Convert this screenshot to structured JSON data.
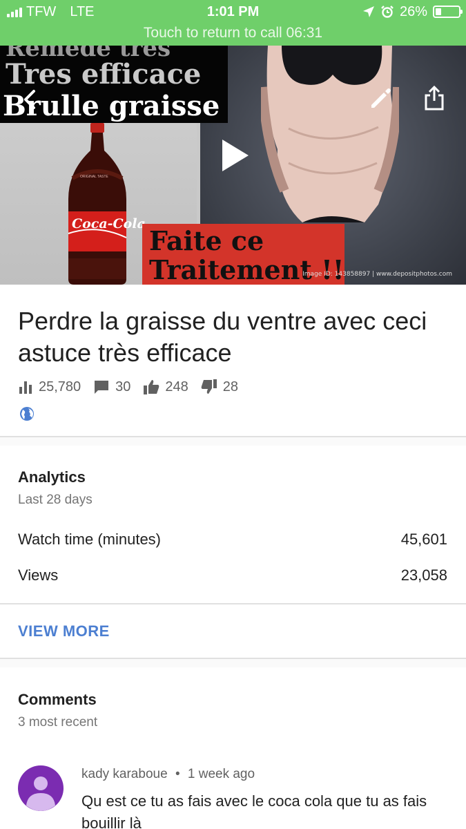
{
  "status_bar": {
    "carrier": "TFW",
    "network": "LTE",
    "time": "1:01 PM",
    "battery": "26%",
    "battery_level": 0.26,
    "call_banner": "Touch to return to call 06:31",
    "color": "#6fcf6a"
  },
  "thumbnail": {
    "overlay_line1": "Remede très",
    "overlay_line2": "Tres efficace",
    "overlay_line3": "Brulle graisse",
    "red_line1": "Faite ce",
    "red_line2": "Traitement !!",
    "bottle_label": "Coca-Cola",
    "bottle_small": "ORIGINAL TASTE",
    "watermark": "Image ID: 143858897 | www.depositphotos.com",
    "icons": [
      "back-arrow-icon",
      "edit-pencil-icon",
      "share-icon",
      "play-icon"
    ]
  },
  "video": {
    "title": "Perdre la graisse du ventre  avec ceci astuce très efficace",
    "views": "25,780",
    "comments": "30",
    "likes": "248",
    "dislikes": "28",
    "visibility_icon": "globe-icon",
    "accent": "#4c7fd1"
  },
  "analytics": {
    "title": "Analytics",
    "period": "Last 28 days",
    "rows": [
      {
        "label": "Watch time (minutes)",
        "value": "45,601"
      },
      {
        "label": "Views",
        "value": "23,058"
      }
    ],
    "view_more": "VIEW MORE"
  },
  "comments": {
    "title": "Comments",
    "subtitle": "3 most recent",
    "items": [
      {
        "author": "kady karaboue",
        "separator": "•",
        "time": "1 week ago",
        "text": "Qu est ce tu as fais avec le coca cola que tu as fais bouillir là",
        "avatar_color": "#7b2cb1"
      }
    ]
  }
}
